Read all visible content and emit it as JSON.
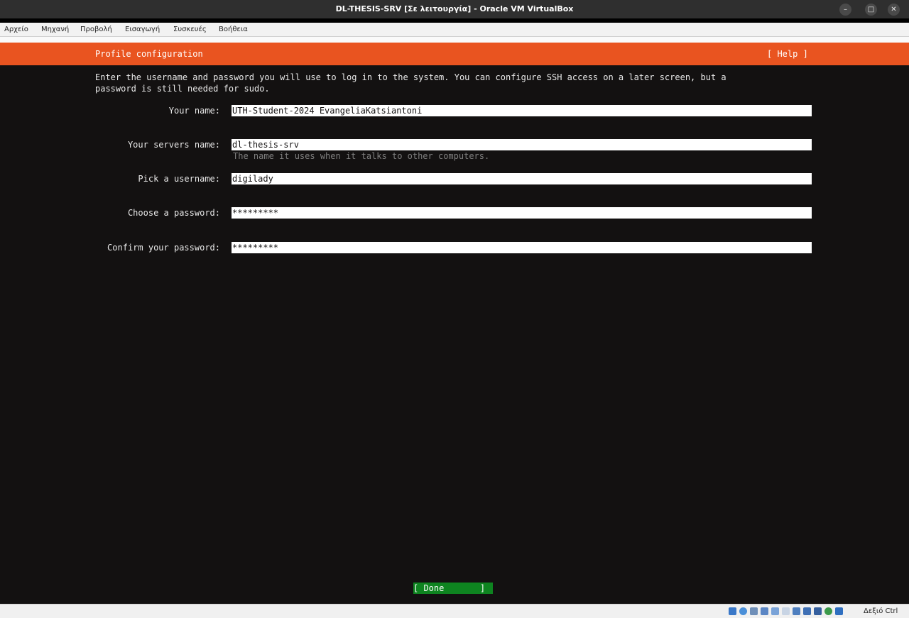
{
  "window": {
    "title": "DL-THESIS-SRV [Σε λειτουργία] - Oracle VM VirtualBox",
    "minimize_glyph": "–",
    "maximize_glyph": "□",
    "close_glyph": "✕"
  },
  "menu": {
    "items": [
      "Αρχείο",
      "Μηχανή",
      "Προβολή",
      "Εισαγωγή",
      "Συσκευές",
      "Βοήθεια"
    ]
  },
  "installer": {
    "header_title": "Profile configuration",
    "help": "[ Help ]",
    "intro_line1": "Enter the username and password you will use to log in to the system. You can configure SSH access on a later screen, but a",
    "intro_line2": "password is still needed for sudo.",
    "fields": [
      {
        "label": "Your name:",
        "value": "UTH-Student-2024 EvangeliaKatsiantoni"
      },
      {
        "label": "Your servers name:",
        "value": "dl-thesis-srv",
        "hint": "The name it uses when it talks to other computers."
      },
      {
        "label": "Pick a username:",
        "value": "digilady"
      },
      {
        "label": "Choose a password:",
        "value": "*********"
      },
      {
        "label": "Confirm your password:",
        "value": "*********"
      }
    ],
    "done_button": "[ Done       ]"
  },
  "statusbar": {
    "icons": [
      "hard-disk-icon",
      "optical-disk-icon",
      "audio-icon",
      "network-icon",
      "usb-icon",
      "shared-folder-icon",
      "display-icon",
      "video-capture-icon",
      "mouse-integration-icon",
      "cpu-activity-icon",
      "keyboard-icon"
    ],
    "host_key": "Δεξιό Ctrl"
  },
  "colors": {
    "accent": "#e95420",
    "done_button": "#0e8420",
    "screen_bg": "#131111"
  }
}
